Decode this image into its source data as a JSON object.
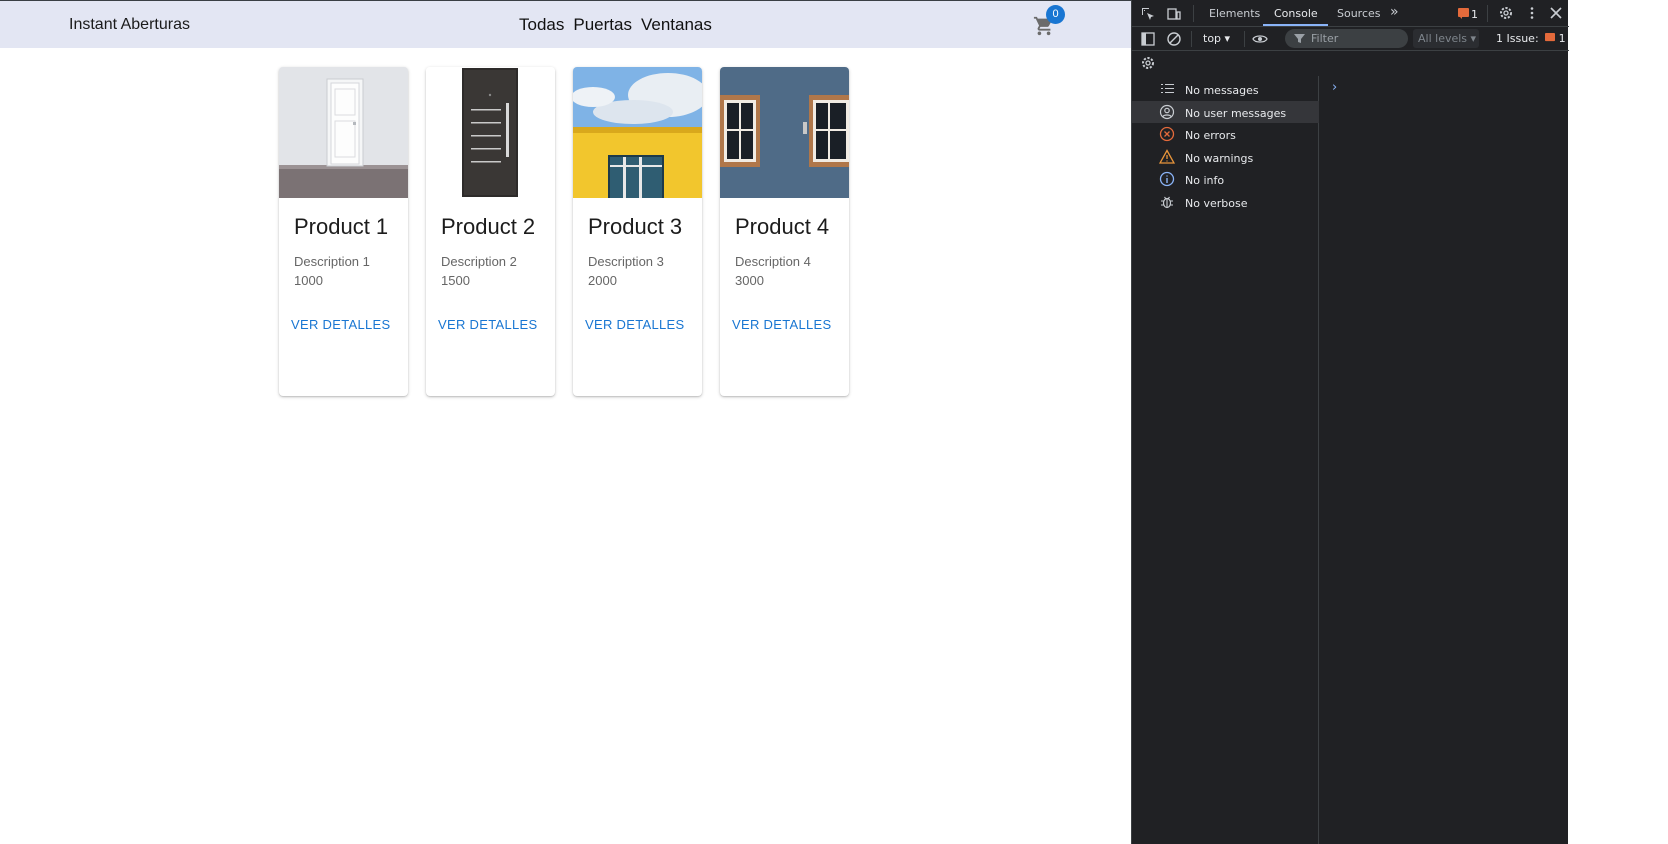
{
  "app": {
    "brand": "Instant Aberturas",
    "nav": [
      "Todas",
      "Puertas",
      "Ventanas"
    ],
    "cart_count": "0"
  },
  "products": [
    {
      "title": "Product 1",
      "description": "Description 1",
      "price": "1000",
      "button": "VER DETALLES",
      "image": "white-door"
    },
    {
      "title": "Product 2",
      "description": "Description 2",
      "price": "1500",
      "button": "VER DETALLES",
      "image": "dark-door"
    },
    {
      "title": "Product 3",
      "description": "Description 3",
      "price": "2000",
      "button": "VER DETALLES",
      "image": "yellow-building-window"
    },
    {
      "title": "Product 4",
      "description": "Description 4",
      "price": "3000",
      "button": "VER DETALLES",
      "image": "blue-wall-windows"
    }
  ],
  "devtools": {
    "tabs": [
      "Elements",
      "Console",
      "Sources"
    ],
    "active_tab": "Console",
    "issue_badge": "1",
    "context": "top",
    "filter_placeholder": "Filter",
    "levels": "All levels",
    "issues_label": "1 Issue:",
    "issues_count": "1",
    "sidebar": [
      {
        "label": "No messages",
        "icon": "list-icon"
      },
      {
        "label": "No user messages",
        "icon": "user-icon"
      },
      {
        "label": "No errors",
        "icon": "error-icon"
      },
      {
        "label": "No warnings",
        "icon": "warning-icon"
      },
      {
        "label": "No info",
        "icon": "info-icon"
      },
      {
        "label": "No verbose",
        "icon": "bug-icon"
      }
    ],
    "selected_sidebar": "No user messages"
  },
  "colors": {
    "header_bg": "#e3e6f3",
    "accent": "#1976d2",
    "devtools_bg": "#202124"
  }
}
